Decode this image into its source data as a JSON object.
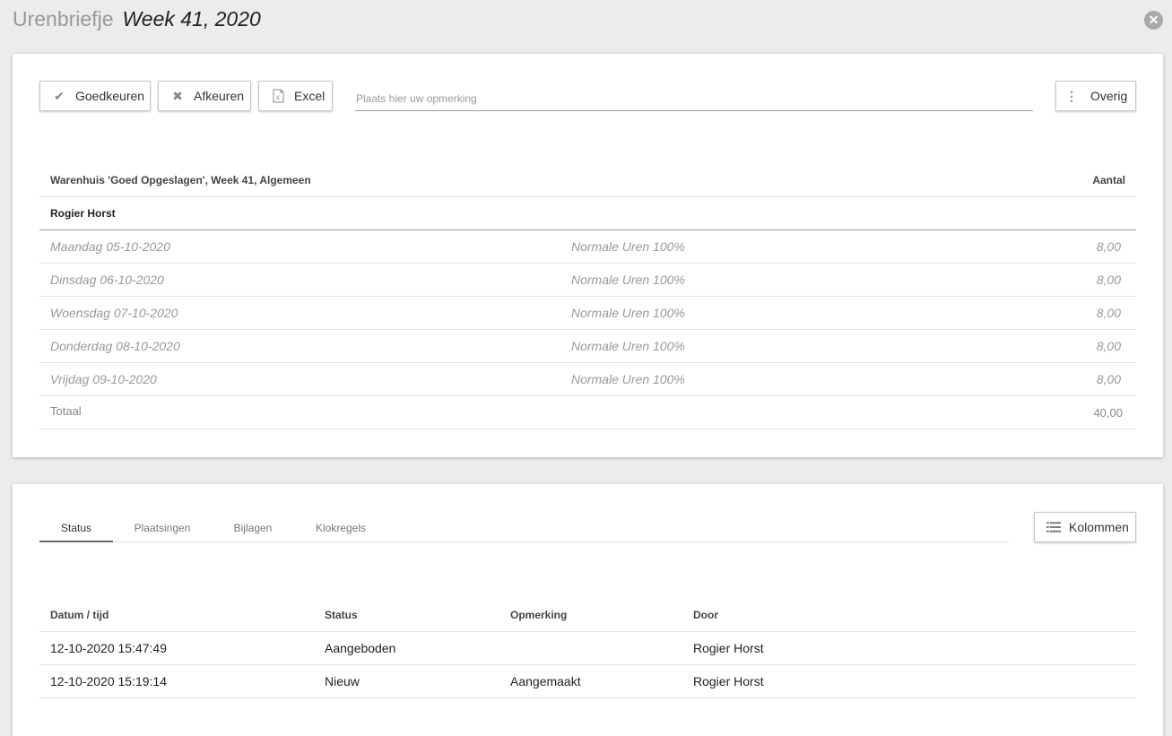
{
  "header": {
    "app_title": "Urenbriefje",
    "week_title": "Week 41, 2020",
    "close_glyph": "✕"
  },
  "toolbar": {
    "approve_label": "Goedkeuren",
    "reject_label": "Afkeuren",
    "excel_label": "Excel",
    "remark_placeholder": "Plaats hier uw opmerking",
    "more_label": "Overig"
  },
  "hours_table": {
    "title": "Warenhuis 'Goed Opgeslagen', Week 41, Algemeen",
    "amount_header": "Aantal",
    "person": "Rogier Horst",
    "rows": [
      {
        "day": "Maandag 05-10-2020",
        "type": "Normale Uren 100%",
        "amount": "8,00"
      },
      {
        "day": "Dinsdag 06-10-2020",
        "type": "Normale Uren 100%",
        "amount": "8,00"
      },
      {
        "day": "Woensdag 07-10-2020",
        "type": "Normale Uren 100%",
        "amount": "8,00"
      },
      {
        "day": "Donderdag 08-10-2020",
        "type": "Normale Uren 100%",
        "amount": "8,00"
      },
      {
        "day": "Vrijdag 09-10-2020",
        "type": "Normale Uren 100%",
        "amount": "8,00"
      }
    ],
    "total_label": "Totaal",
    "total_value": "40,00"
  },
  "tabs": [
    "Status",
    "Plaatsingen",
    "Bijlagen",
    "Klokregels"
  ],
  "columns_button": "Kolommen",
  "status_table": {
    "headers": [
      "Datum / tijd",
      "Status",
      "Opmerking",
      "Door"
    ],
    "rows": [
      [
        "12-10-2020 15:47:49",
        "Aangeboden",
        "",
        "Rogier Horst"
      ],
      [
        "12-10-2020 15:19:14",
        "Nieuw",
        "Aangemaakt",
        "Rogier Horst"
      ]
    ]
  }
}
